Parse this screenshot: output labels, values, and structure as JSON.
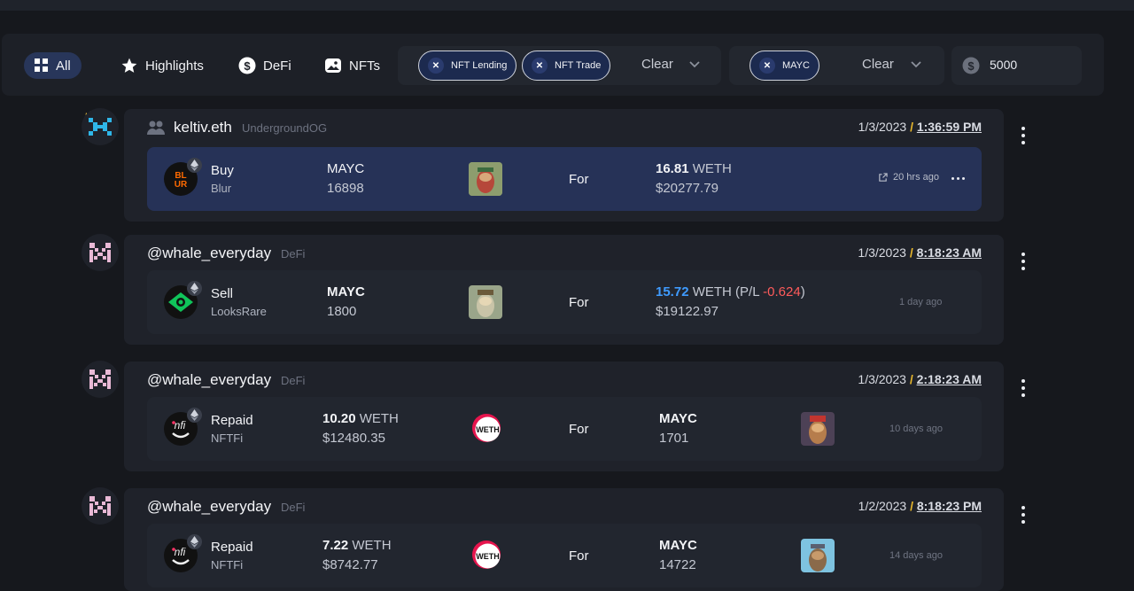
{
  "filters": {
    "tabs": [
      {
        "label": "All",
        "icon": "grid-icon",
        "active": true
      },
      {
        "label": "Highlights",
        "icon": "star-icon",
        "active": false
      },
      {
        "label": "DeFi",
        "icon": "dollar-coin-icon",
        "active": false
      },
      {
        "label": "NFTs",
        "icon": "image-icon",
        "active": false
      }
    ],
    "type_filters": [
      "NFT Lending",
      "NFT Trade"
    ],
    "type_clear": "Clear",
    "collection_filters": [
      "MAYC"
    ],
    "collection_clear": "Clear",
    "min_amount": "5000"
  },
  "feed": [
    {
      "handle": "keltiv.eth",
      "tag": "UndergroundOG",
      "date": "1/3/2023",
      "slash": "/",
      "time": "1:36:59 PM",
      "action": "Buy",
      "marketplace": "Blur",
      "asset_name": "MAYC",
      "asset_sub": "16898",
      "for_label": "For",
      "amount_value": "16.81",
      "amount_unit": "WETH",
      "usd": "$20277.79",
      "ago": "20 hrs ago"
    },
    {
      "handle": "@whale_everyday",
      "tag": "DeFi",
      "date": "1/3/2023",
      "slash": "/",
      "time": "8:18:23 AM",
      "action": "Sell",
      "marketplace": "LooksRare",
      "asset_name": "MAYC",
      "asset_sub": "1800",
      "for_label": "For",
      "amount_value": "15.72",
      "amount_unit": "WETH (P/L",
      "pl": "-0.624",
      "pl_close": ")",
      "usd": "$19122.97",
      "ago": "1 day ago"
    },
    {
      "handle": "@whale_everyday",
      "tag": "DeFi",
      "date": "1/3/2023",
      "slash": "/",
      "time": "2:18:23 AM",
      "action": "Repaid",
      "marketplace": "NFTFi",
      "amount_value": "10.20",
      "amount_unit": "WETH",
      "usd": "$12480.35",
      "for_label": "For",
      "asset_name": "MAYC",
      "asset_sub": "1701",
      "ago": "10 days ago"
    },
    {
      "handle": "@whale_everyday",
      "tag": "DeFi",
      "date": "1/2/2023",
      "slash": "/",
      "time": "8:18:23 PM",
      "action": "Repaid",
      "marketplace": "NFTFi",
      "amount_value": "7.22",
      "amount_unit": "WETH",
      "usd": "$8742.77",
      "for_label": "For",
      "asset_name": "MAYC",
      "asset_sub": "14722",
      "ago": "14 days ago"
    }
  ],
  "colors": {
    "background": "#16181d",
    "card": "#1f222a",
    "highlight_row": "#263257",
    "accent_yellow": "#e8b72c",
    "pl_negative": "#ff5b5b",
    "weth_blue": "#3f9bff"
  }
}
